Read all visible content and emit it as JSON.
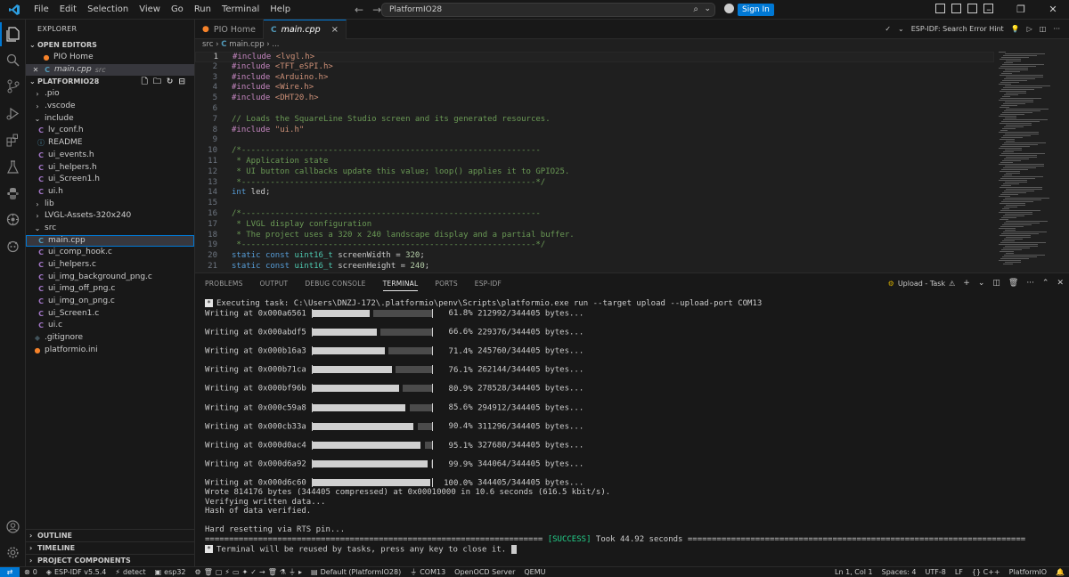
{
  "titlebar": {
    "menus": [
      "File",
      "Edit",
      "Selection",
      "View",
      "Go",
      "Run",
      "Terminal",
      "Help"
    ],
    "search_text": "PlatformIO28",
    "sign_in": "Sign In"
  },
  "activity": [
    "explorer-icon",
    "search-icon",
    "source-control-icon",
    "run-debug-icon",
    "extensions-icon",
    "testing-icon",
    "python-icon",
    "platformio-icon",
    "copilot-icon",
    "account-icon",
    "settings-gear-icon"
  ],
  "sidebar": {
    "title": "EXPLORER",
    "open_editors_title": "OPEN EDITORS",
    "open_editors": [
      {
        "name": "PIO Home",
        "icon": "pio",
        "hint": ""
      },
      {
        "name": "main.cpp",
        "icon": "cpp",
        "hint": "src"
      }
    ],
    "workspace_title": "PLATFORMIO28",
    "tree": [
      {
        "name": ".pio",
        "kind": "folder",
        "depth": 0,
        "open": false
      },
      {
        "name": ".vscode",
        "kind": "folder",
        "depth": 0,
        "open": false
      },
      {
        "name": "include",
        "kind": "folder",
        "depth": 0,
        "open": true
      },
      {
        "name": "lv_conf.h",
        "kind": "c",
        "depth": 1
      },
      {
        "name": "README",
        "kind": "info",
        "depth": 1
      },
      {
        "name": "ui_events.h",
        "kind": "c",
        "depth": 1
      },
      {
        "name": "ui_helpers.h",
        "kind": "c",
        "depth": 1
      },
      {
        "name": "ui_Screen1.h",
        "kind": "c",
        "depth": 1
      },
      {
        "name": "ui.h",
        "kind": "c",
        "depth": 1
      },
      {
        "name": "lib",
        "kind": "folder",
        "depth": 0,
        "open": false
      },
      {
        "name": "LVGL-Assets-320x240",
        "kind": "folder",
        "depth": 0,
        "open": false
      },
      {
        "name": "src",
        "kind": "folder",
        "depth": 0,
        "open": true
      },
      {
        "name": "main.cpp",
        "kind": "cpp",
        "depth": 1,
        "selected": true
      },
      {
        "name": "ui_comp_hook.c",
        "kind": "c",
        "depth": 1
      },
      {
        "name": "ui_helpers.c",
        "kind": "c",
        "depth": 1
      },
      {
        "name": "ui_img_background_png.c",
        "kind": "c",
        "depth": 1
      },
      {
        "name": "ui_img_off_png.c",
        "kind": "c",
        "depth": 1
      },
      {
        "name": "ui_img_on_png.c",
        "kind": "c",
        "depth": 1
      },
      {
        "name": "ui_Screen1.c",
        "kind": "c",
        "depth": 1
      },
      {
        "name": "ui.c",
        "kind": "c",
        "depth": 1
      },
      {
        "name": ".gitignore",
        "kind": "git",
        "depth": 0
      },
      {
        "name": "platformio.ini",
        "kind": "pio",
        "depth": 0
      }
    ],
    "bottom_sections": [
      "OUTLINE",
      "TIMELINE",
      "PROJECT COMPONENTS"
    ]
  },
  "tabs": [
    {
      "label": "PIO Home",
      "icon": "pio",
      "active": false
    },
    {
      "label": "main.cpp",
      "icon": "cpp",
      "active": true
    }
  ],
  "tabs_right": {
    "hint": "ESP-IDF: Search Error Hint"
  },
  "breadcrumb": [
    "src",
    "main.cpp",
    "..."
  ],
  "editor_lines": [
    [
      {
        "t": "#include ",
        "c": "pp"
      },
      {
        "t": "<lvgl.h>",
        "c": "str"
      }
    ],
    [
      {
        "t": "#include ",
        "c": "pp"
      },
      {
        "t": "<TFT_eSPI.h>",
        "c": "str"
      }
    ],
    [
      {
        "t": "#include ",
        "c": "pp"
      },
      {
        "t": "<Arduino.h>",
        "c": "str"
      }
    ],
    [
      {
        "t": "#include ",
        "c": "pp"
      },
      {
        "t": "<Wire.h>",
        "c": "str"
      }
    ],
    [
      {
        "t": "#include ",
        "c": "pp"
      },
      {
        "t": "<DHT20.h>",
        "c": "str"
      }
    ],
    [],
    [
      {
        "t": "// Loads the SquareLine Studio screen and its generated resources.",
        "c": "com"
      }
    ],
    [
      {
        "t": "#include ",
        "c": "pp"
      },
      {
        "t": "\"ui.h\"",
        "c": "str"
      }
    ],
    [],
    [
      {
        "t": "/*--------------------------------------------------------------",
        "c": "com"
      }
    ],
    [
      {
        "t": " * Application state",
        "c": "com"
      }
    ],
    [
      {
        "t": " * UI button callbacks update this value; loop() applies it to GPIO25.",
        "c": "com"
      }
    ],
    [
      {
        "t": " *-------------------------------------------------------------*/",
        "c": "com"
      }
    ],
    [
      {
        "t": "int",
        "c": "kw"
      },
      {
        "t": " led;",
        "c": ""
      }
    ],
    [],
    [
      {
        "t": "/*--------------------------------------------------------------",
        "c": "com"
      }
    ],
    [
      {
        "t": " * LVGL display configuration",
        "c": "com"
      }
    ],
    [
      {
        "t": " * The project uses a 320 x 240 landscape display and a partial buffer.",
        "c": "com"
      }
    ],
    [
      {
        "t": " *-------------------------------------------------------------*/",
        "c": "com"
      }
    ],
    [
      {
        "t": "static",
        "c": "kw"
      },
      {
        "t": " ",
        "c": ""
      },
      {
        "t": "const",
        "c": "kw"
      },
      {
        "t": " ",
        "c": ""
      },
      {
        "t": "uint16_t",
        "c": "ty"
      },
      {
        "t": " screenWidth = ",
        "c": ""
      },
      {
        "t": "320",
        "c": "num"
      },
      {
        "t": ";",
        "c": ""
      }
    ],
    [
      {
        "t": "static",
        "c": "kw"
      },
      {
        "t": " ",
        "c": ""
      },
      {
        "t": "const",
        "c": "kw"
      },
      {
        "t": " ",
        "c": ""
      },
      {
        "t": "uint16_t",
        "c": "ty"
      },
      {
        "t": " screenHeight = ",
        "c": ""
      },
      {
        "t": "240",
        "c": "num"
      },
      {
        "t": ";",
        "c": ""
      }
    ]
  ],
  "panel": {
    "tabs": [
      "PROBLEMS",
      "OUTPUT",
      "DEBUG CONSOLE",
      "TERMINAL",
      "PORTS",
      "ESP-IDF"
    ],
    "active_tab": "TERMINAL",
    "task_label": "Upload - Task"
  },
  "terminal": {
    "task_line": "Executing task: C:\\Users\\DNZJ-172\\.platformio\\penv\\Scripts\\platformio.exe run --target upload --upload-port COM13",
    "writes": [
      {
        "addr": "0x000a6561",
        "progress": 0.618,
        "pct": "61.8%",
        "bytes": "212992/344405 bytes..."
      },
      {
        "addr": "0x000abdf5",
        "progress": 0.666,
        "pct": "66.6%",
        "bytes": "229376/344405 bytes..."
      },
      {
        "addr": "0x000b16a3",
        "progress": 0.714,
        "pct": "71.4%",
        "bytes": "245760/344405 bytes..."
      },
      {
        "addr": "0x000b71ca",
        "progress": 0.761,
        "pct": "76.1%",
        "bytes": "262144/344405 bytes..."
      },
      {
        "addr": "0x000bf96b",
        "progress": 0.809,
        "pct": "80.9%",
        "bytes": "278528/344405 bytes..."
      },
      {
        "addr": "0x000c59a8",
        "progress": 0.856,
        "pct": "85.6%",
        "bytes": "294912/344405 bytes..."
      },
      {
        "addr": "0x000cb33a",
        "progress": 0.904,
        "pct": "90.4%",
        "bytes": "311296/344405 bytes..."
      },
      {
        "addr": "0x000d0ac4",
        "progress": 0.951,
        "pct": "95.1%",
        "bytes": "327680/344405 bytes..."
      },
      {
        "addr": "0x000d6a92",
        "progress": 0.999,
        "pct": "99.9%",
        "bytes": "344064/344405 bytes..."
      },
      {
        "addr": "0x000d6c60",
        "progress": 1.0,
        "pct": "100.0%",
        "bytes": "344405/344405 bytes..."
      }
    ],
    "wrote": "Wrote 814176 bytes (344405 compressed) at 0x00010000 in 10.6 seconds (616.5 kbit/s).",
    "verifying": "Verifying written data...",
    "hash": "Hash of data verified.",
    "reset": "Hard resetting via RTS pin...",
    "success_tag": "[SUCCESS]",
    "success_time": "Took 44.92 seconds",
    "reuse": "Terminal will be reused by tasks, press any key to close it."
  },
  "statusbar": {
    "left": [
      {
        "icon": "error-icon",
        "text": "0"
      },
      {
        "icon": "esp-idf-icon",
        "text": "ESP-IDF v5.5.4"
      },
      {
        "icon": "",
        "text": "detect"
      },
      {
        "icon": "",
        "text": "esp32"
      }
    ],
    "mid": [
      {
        "icon": "",
        "text": "Default (PlatformIO28)"
      },
      {
        "icon": "",
        "text": "COM13"
      },
      {
        "icon": "",
        "text": "OpenOCD Server"
      },
      {
        "icon": "",
        "text": "QEMU"
      }
    ],
    "right": [
      "Ln 1, Col 1",
      "Spaces: 4",
      "UTF-8",
      "LF",
      "{} C++",
      "PlatformIO"
    ]
  }
}
